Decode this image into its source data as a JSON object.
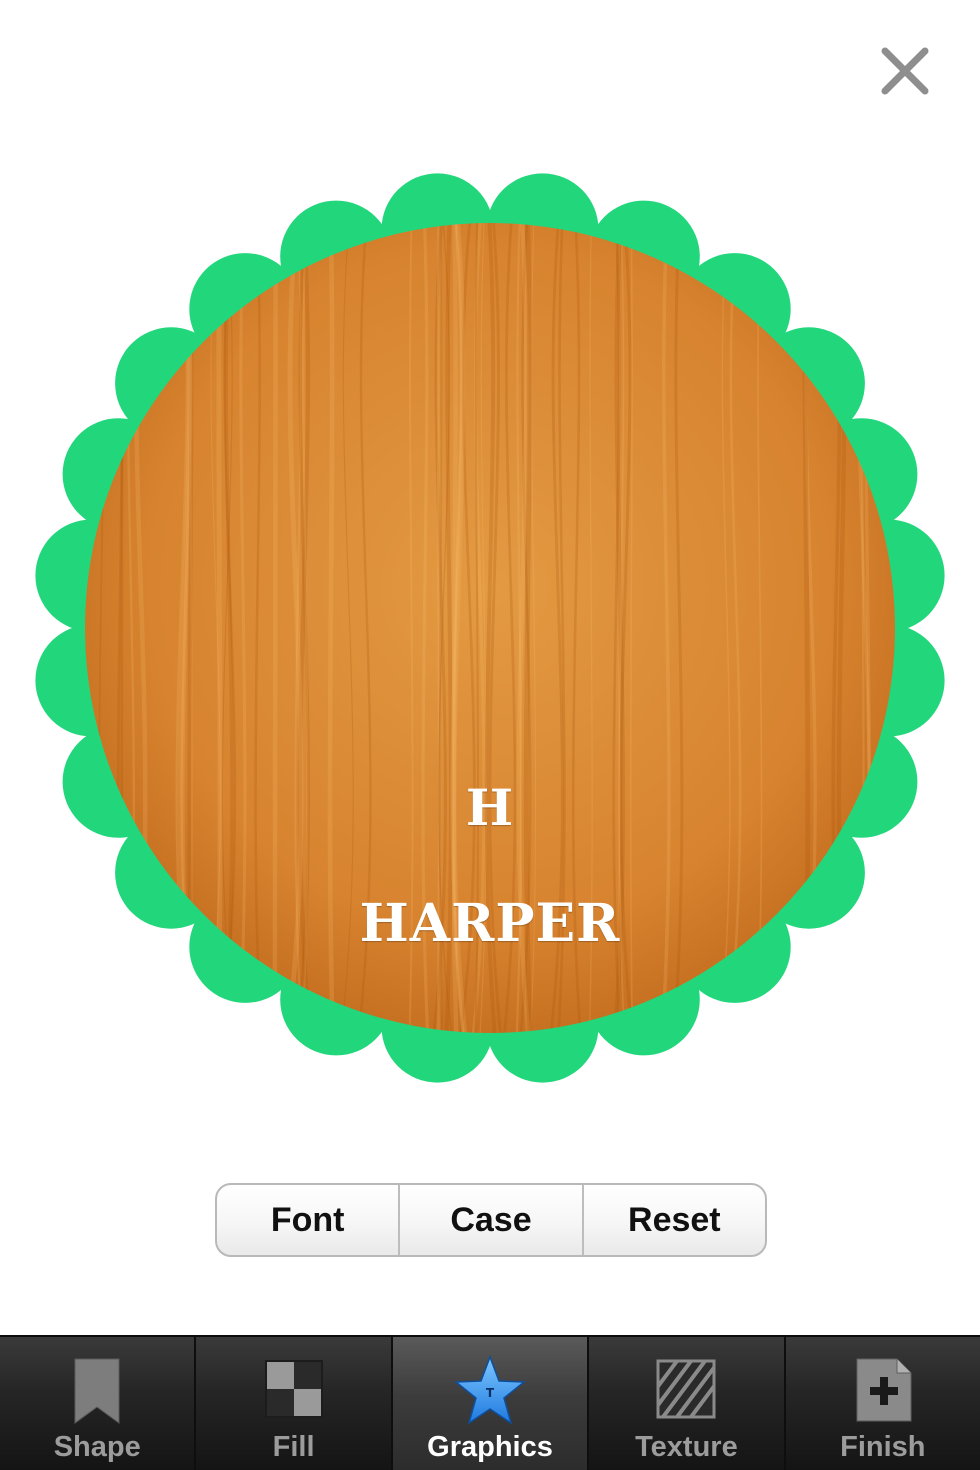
{
  "badge": {
    "initial": "H",
    "name": "HARPER"
  },
  "colors": {
    "badge_border": "#22d67c",
    "wood_base": "#d9822e"
  },
  "segmented": {
    "font_label": "Font",
    "case_label": "Case",
    "reset_label": "Reset"
  },
  "tabbar": {
    "active": "Graphics",
    "tabs": [
      {
        "label": "Shape",
        "icon": "bookmark-icon"
      },
      {
        "label": "Fill",
        "icon": "checker-icon"
      },
      {
        "label": "Graphics",
        "icon": "star-icon"
      },
      {
        "label": "Texture",
        "icon": "hatch-icon"
      },
      {
        "label": "Finish",
        "icon": "add-document-icon"
      }
    ]
  }
}
